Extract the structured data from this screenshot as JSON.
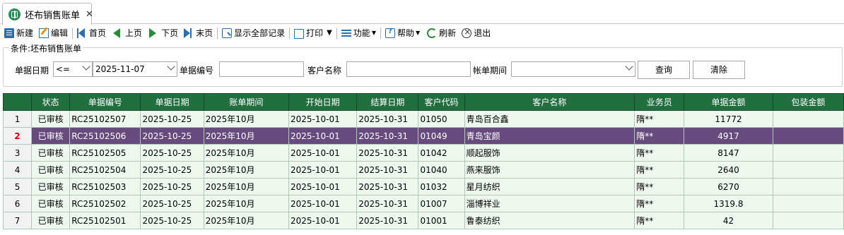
{
  "tab": {
    "title": "坯布销售账单",
    "close": "✕"
  },
  "toolbar": {
    "new": "新建",
    "edit": "编辑",
    "first": "首页",
    "prev": "上页",
    "next": "下页",
    "last": "末页",
    "show_all": "显示全部记录",
    "print": "打印",
    "function": "功能",
    "help": "帮助",
    "refresh": "刷新",
    "exit": "退出"
  },
  "condition": {
    "legend": "条件:坯布销售账单",
    "doc_date_label": "单据日期",
    "operator": "<=",
    "date_value": "2025-11-07",
    "doc_no_label": "单据编号",
    "doc_no_value": "",
    "customer_label": "客户名称",
    "customer_value": "",
    "period_label": "帐单期间",
    "period_value": "",
    "query_btn": "查询",
    "clear_btn": "清除"
  },
  "grid": {
    "columns": [
      "",
      "状态",
      "单据编号",
      "单据日期",
      "账单期间",
      "开始日期",
      "结算日期",
      "客户代码",
      "客户名称",
      "业务员",
      "单据金额",
      "包装金额"
    ],
    "selected_index": 1,
    "rows": [
      {
        "num": "1",
        "status": "已审核",
        "doc_no": "RC25102507",
        "doc_date": "2025-10-25",
        "period": "2025年10月",
        "start": "2025-10-01",
        "settle": "2025-10-31",
        "cust_code": "01050",
        "cust_name": "青岛百合鑫",
        "sales": "隋**",
        "amount": "11772",
        "pack": ""
      },
      {
        "num": "2",
        "status": "已审核",
        "doc_no": "RC25102506",
        "doc_date": "2025-10-25",
        "period": "2025年10月",
        "start": "2025-10-01",
        "settle": "2025-10-31",
        "cust_code": "01049",
        "cust_name": "青岛宝颜",
        "sales": "隋**",
        "amount": "4917",
        "pack": ""
      },
      {
        "num": "3",
        "status": "已审核",
        "doc_no": "RC25102505",
        "doc_date": "2025-10-25",
        "period": "2025年10月",
        "start": "2025-10-01",
        "settle": "2025-10-31",
        "cust_code": "01042",
        "cust_name": "顺起服饰",
        "sales": "隋**",
        "amount": "8147",
        "pack": ""
      },
      {
        "num": "4",
        "status": "已审核",
        "doc_no": "RC25102504",
        "doc_date": "2025-10-25",
        "period": "2025年10月",
        "start": "2025-10-01",
        "settle": "2025-10-31",
        "cust_code": "01040",
        "cust_name": "燕来服饰",
        "sales": "隋**",
        "amount": "2640",
        "pack": ""
      },
      {
        "num": "5",
        "status": "已审核",
        "doc_no": "RC25102503",
        "doc_date": "2025-10-25",
        "period": "2025年10月",
        "start": "2025-10-01",
        "settle": "2025-10-31",
        "cust_code": "01032",
        "cust_name": "星月纺织",
        "sales": "隋**",
        "amount": "6270",
        "pack": ""
      },
      {
        "num": "6",
        "status": "已审核",
        "doc_no": "RC25102502",
        "doc_date": "2025-10-25",
        "period": "2025年10月",
        "start": "2025-10-01",
        "settle": "2025-10-31",
        "cust_code": "01007",
        "cust_name": "淄博祥业",
        "sales": "隋**",
        "amount": "1319.8",
        "pack": ""
      },
      {
        "num": "7",
        "status": "已审核",
        "doc_no": "RC25102501",
        "doc_date": "2025-10-25",
        "period": "2025年10月",
        "start": "2025-10-01",
        "settle": "2025-10-31",
        "cust_code": "01001",
        "cust_name": "鲁泰纺织",
        "sales": "隋**",
        "amount": "42",
        "pack": ""
      }
    ]
  },
  "colors": {
    "header_bg": "#216e3f",
    "row_bg": "#eff8ef",
    "selected_row_bg": "#684b7e",
    "selected_row_num": "#d40000"
  }
}
